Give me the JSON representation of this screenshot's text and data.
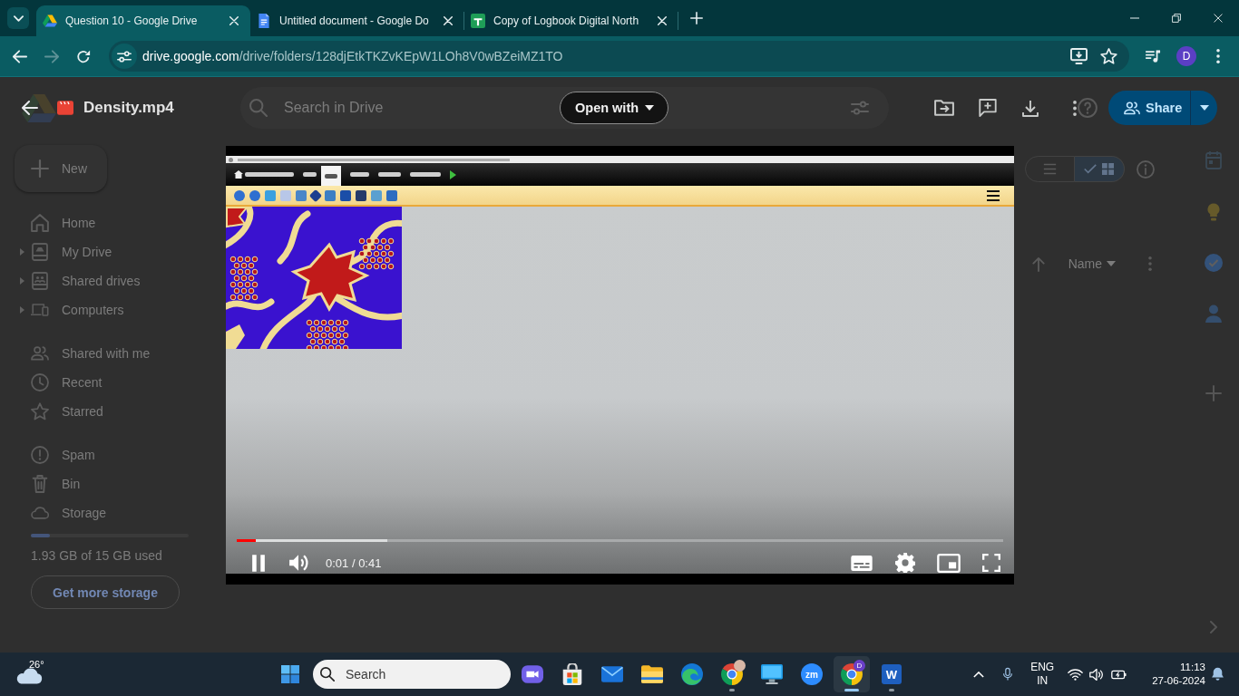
{
  "browser": {
    "tabs": [
      {
        "title": "Question 10 - Google Drive",
        "kind": "drive",
        "selected": true
      },
      {
        "title": "Untitled document - Google Do",
        "kind": "docs",
        "selected": false
      },
      {
        "title": "Copy of Logbook Digital North",
        "kind": "sheets",
        "selected": false
      }
    ],
    "nav_buttons": [
      {
        "kind": "back",
        "disabled": false
      },
      {
        "kind": "forward",
        "disabled": true
      },
      {
        "kind": "reload",
        "disabled": false
      }
    ],
    "address": {
      "host": "drive.google.com",
      "path": "/drive/folders/128djEtkTKZvKEpW1LOh8V0wBZeiMZ1TO"
    },
    "bookmarked": false,
    "profile": {
      "initial": "D"
    }
  },
  "drive": {
    "file_name": "Density.mp4",
    "search": {
      "placeholder": "Search in Drive"
    },
    "open_with": "Open with",
    "share": "Share",
    "new_button": "New",
    "sidebar": {
      "sections": [
        {
          "items": [
            {
              "kind": "home",
              "label": "Home",
              "expandable": false,
              "selected": false
            },
            {
              "kind": "mydrive",
              "label": "My Drive",
              "expandable": true,
              "selected": false
            },
            {
              "kind": "shareddrives",
              "label": "Shared drives",
              "expandable": true,
              "selected": false
            },
            {
              "kind": "computers",
              "label": "Computers",
              "expandable": true,
              "selected": false
            }
          ]
        },
        {
          "items": [
            {
              "kind": "shared",
              "label": "Shared with me",
              "expandable": false,
              "selected": false
            },
            {
              "kind": "recent",
              "label": "Recent",
              "expandable": false,
              "selected": false
            },
            {
              "kind": "starred",
              "label": "Starred",
              "expandable": false,
              "selected": false
            }
          ]
        },
        {
          "items": [
            {
              "kind": "spam",
              "label": "Spam",
              "expandable": false,
              "selected": false
            },
            {
              "kind": "bin",
              "label": "Bin",
              "expandable": false,
              "selected": false
            },
            {
              "kind": "storage",
              "label": "Storage",
              "expandable": false,
              "selected": false
            }
          ]
        }
      ]
    },
    "storage": {
      "level": 0.12,
      "text": "1.93 GB of 15 GB used",
      "button": "Get more storage"
    },
    "view_toggle": [
      {
        "kind": "list",
        "selected": false
      },
      {
        "kind": "grid",
        "selected": true
      }
    ],
    "sort": {
      "label": "Name",
      "ascending": true
    }
  },
  "video": {
    "playing": true,
    "progress": {
      "level": 0.025,
      "buffered": {
        "level": 0.196
      }
    },
    "time": "0:01 / 0:41"
  },
  "taskbar": {
    "weather": {
      "temperature": "26°"
    },
    "search": {
      "placeholder": "Search"
    },
    "apps": [
      {
        "kind": "meet",
        "running": false,
        "selected": false
      },
      {
        "kind": "store",
        "running": false,
        "selected": false
      },
      {
        "kind": "mail",
        "running": false,
        "selected": false
      },
      {
        "kind": "explorer",
        "running": false,
        "selected": false
      },
      {
        "kind": "edge",
        "running": false,
        "selected": false
      },
      {
        "kind": "chrome",
        "avatar": true,
        "running": true,
        "selected": false
      },
      {
        "kind": "monitor",
        "running": false,
        "selected": false
      },
      {
        "kind": "zoom",
        "label": "zm",
        "running": false,
        "selected": false
      },
      {
        "kind": "chrome",
        "avatar": false,
        "badge": "D",
        "running": true,
        "selected": true
      },
      {
        "kind": "word",
        "label": "W",
        "running": true,
        "selected": false
      }
    ],
    "tray": {
      "language": "ENG",
      "region": "IN",
      "time": "11:13",
      "date": "27-06-2024"
    }
  }
}
